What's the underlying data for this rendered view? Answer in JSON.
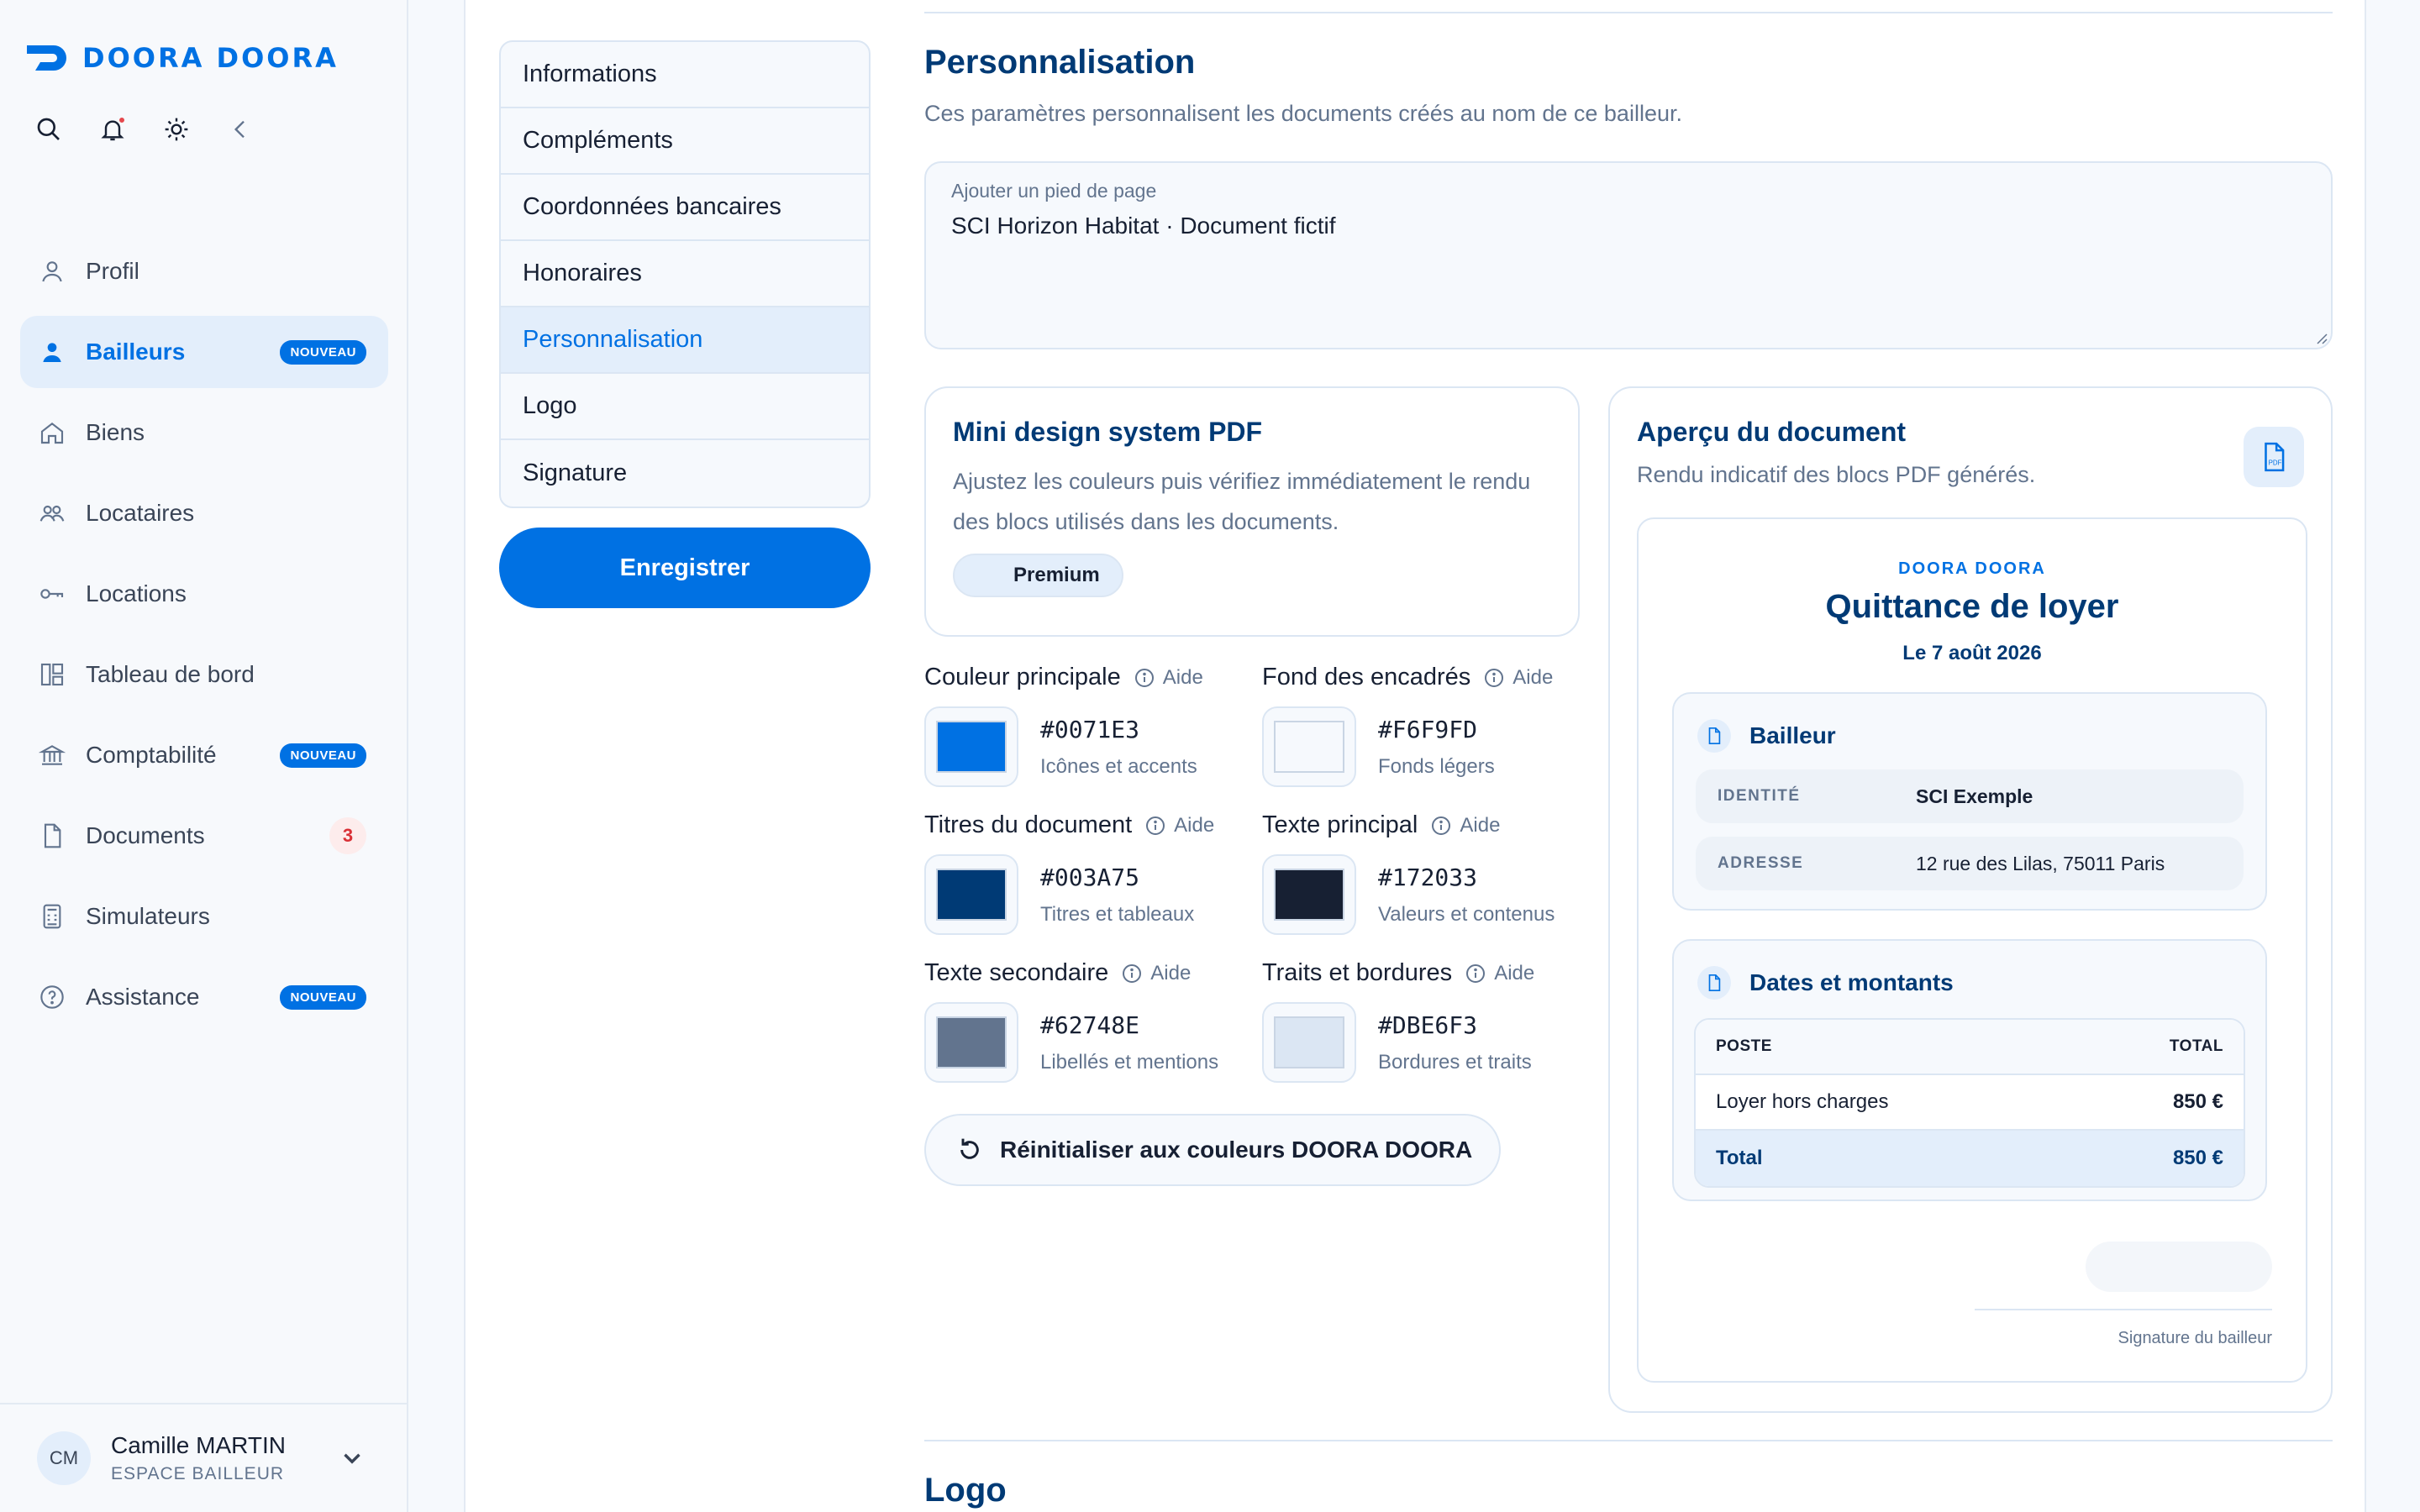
{
  "brand": {
    "name": "DOORA DOORA",
    "accent": "#0071E3"
  },
  "sidebar": {
    "items": [
      {
        "label": "Profil",
        "icon": "user-icon",
        "badge": null
      },
      {
        "label": "Bailleurs",
        "icon": "user-icon",
        "badge": "NOUVEAU",
        "active": true
      },
      {
        "label": "Biens",
        "icon": "home-icon",
        "badge": null
      },
      {
        "label": "Locataires",
        "icon": "users-icon",
        "badge": null
      },
      {
        "label": "Locations",
        "icon": "key-icon",
        "badge": null
      },
      {
        "label": "Tableau de bord",
        "icon": "dashboard-icon",
        "badge": null
      },
      {
        "label": "Comptabilité",
        "icon": "bank-icon",
        "badge": "NOUVEAU"
      },
      {
        "label": "Documents",
        "icon": "document-icon",
        "count": "3"
      },
      {
        "label": "Simulateurs",
        "icon": "calculator-icon",
        "badge": null
      },
      {
        "label": "Assistance",
        "icon": "help-circle-icon",
        "badge": "NOUVEAU"
      }
    ]
  },
  "user": {
    "initials": "CM",
    "name": "Camille MARTIN",
    "role": "ESPACE BAILLEUR"
  },
  "subnav": {
    "items": [
      "Informations",
      "Compléments",
      "Coordonnées bancaires",
      "Honoraires",
      "Personnalisation",
      "Logo",
      "Signature"
    ],
    "active": "Personnalisation",
    "save_label": "Enregistrer"
  },
  "personalisation": {
    "title": "Personnalisation",
    "description": "Ces paramètres personnalisent les documents créés au nom de ce bailleur.",
    "footer_label": "Ajouter un pied de page",
    "footer_value": "SCI Horizon Habitat · Document fictif"
  },
  "mini_design": {
    "title": "Mini design system PDF",
    "text": "Ajustez les couleurs puis vérifiez immédiatement le rendu des blocs utilisés dans les documents.",
    "badge": "Premium"
  },
  "help_label": "Aide",
  "colors": [
    {
      "name": "Couleur principale",
      "hex": "#0071E3",
      "sub": "Icônes et accents"
    },
    {
      "name": "Fond des encadrés",
      "hex": "#F6F9FD",
      "sub": "Fonds légers"
    },
    {
      "name": "Titres du document",
      "hex": "#003A75",
      "sub": "Titres et tableaux"
    },
    {
      "name": "Texte principal",
      "hex": "#172033",
      "sub": "Valeurs et contenus"
    },
    {
      "name": "Texte secondaire",
      "hex": "#62748E",
      "sub": "Libellés et mentions"
    },
    {
      "name": "Traits et bordures",
      "hex": "#DBE6F3",
      "sub": "Bordures et traits"
    }
  ],
  "reset_label": "Réinitialiser aux couleurs DOORA DOORA",
  "preview": {
    "title": "Aperçu du document",
    "subtitle": "Rendu indicatif des blocs PDF générés.",
    "doc_brand": "DOORA DOORA",
    "doc_title": "Quittance de loyer",
    "doc_date": "Le 7 août 2026",
    "bailleur": {
      "title": "Bailleur",
      "rows": [
        {
          "key": "IDENTITÉ",
          "value": "SCI Exemple"
        },
        {
          "key": "ADRESSE",
          "value": "12 rue des Lilas, 75011 Paris"
        }
      ]
    },
    "montants": {
      "title": "Dates et montants",
      "head": [
        "POSTE",
        "TOTAL"
      ],
      "rows": [
        {
          "label": "Loyer hors charges",
          "amount": "850 €"
        }
      ],
      "total": {
        "label": "Total",
        "amount": "850 €"
      }
    },
    "signature_label": "Signature du bailleur"
  },
  "logo_section": {
    "title": "Logo"
  }
}
